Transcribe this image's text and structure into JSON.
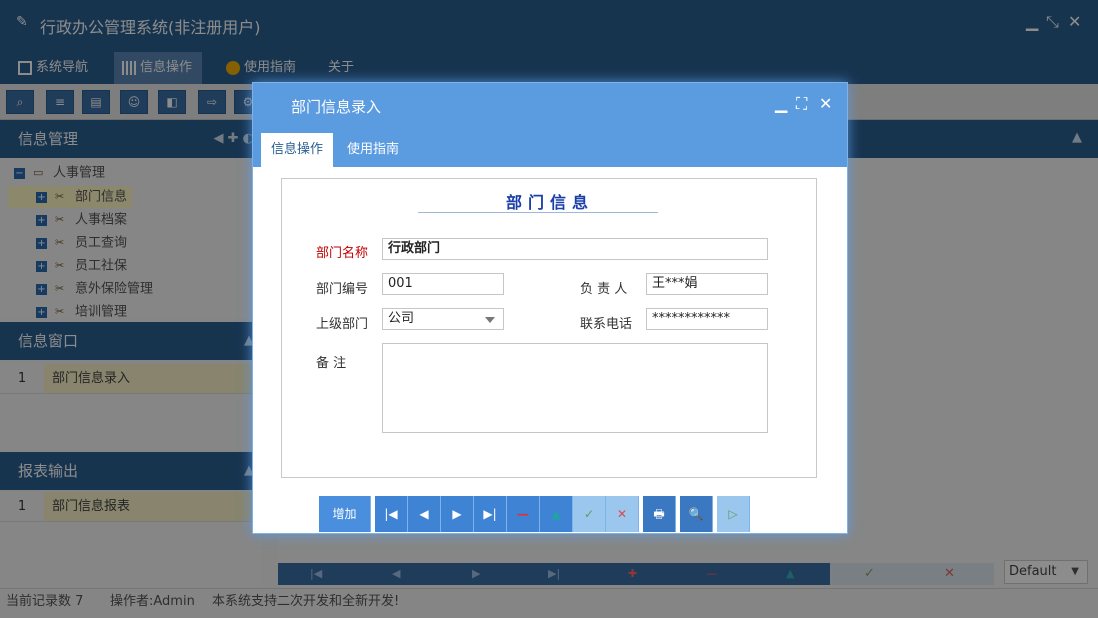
{
  "app": {
    "title": "行政办公管理系统(非注册用户)",
    "menu": [
      "系统导航",
      "信息操作",
      "使用指南",
      "关于"
    ]
  },
  "left": {
    "panel1_title": "信息管理",
    "tree_root": "人事管理",
    "tree_items": [
      "部门信息",
      "人事档案",
      "员工查询",
      "员工社保",
      "意外保险管理",
      "培训管理"
    ],
    "panel2_title": "信息窗口",
    "window_rows": [
      {
        "num": "1",
        "label": "部门信息录入"
      }
    ],
    "panel3_title": "报表输出",
    "report_rows": [
      {
        "num": "1",
        "label": "部门信息报表"
      }
    ]
  },
  "right": {
    "default_select": "Default"
  },
  "status": {
    "records": "当前记录数 7",
    "operator": "操作者:Admin",
    "note": "本系统支持二次开发和全新开发!"
  },
  "dialog": {
    "title": "部门信息录入",
    "tabs": [
      "信息操作",
      "使用指南"
    ],
    "form_title": "部门信息",
    "labels": {
      "name": "部门名称",
      "code": "部门编号",
      "owner": "负 责 人",
      "parent": "上级部门",
      "phone": "联系电话",
      "remark": "备 注"
    },
    "values": {
      "name": "行政部门",
      "code": "001",
      "owner": "王***娟",
      "parent": "公司",
      "phone": "************",
      "remark": ""
    },
    "buttons": {
      "add": "增加",
      "first": "|◀",
      "prev": "◀",
      "next": "▶",
      "last": "▶|",
      "delete": "—",
      "up": "▲",
      "confirm": "✓",
      "cancel": "✕",
      "print": "🖶",
      "preview": "🔍",
      "run": "▷"
    }
  }
}
